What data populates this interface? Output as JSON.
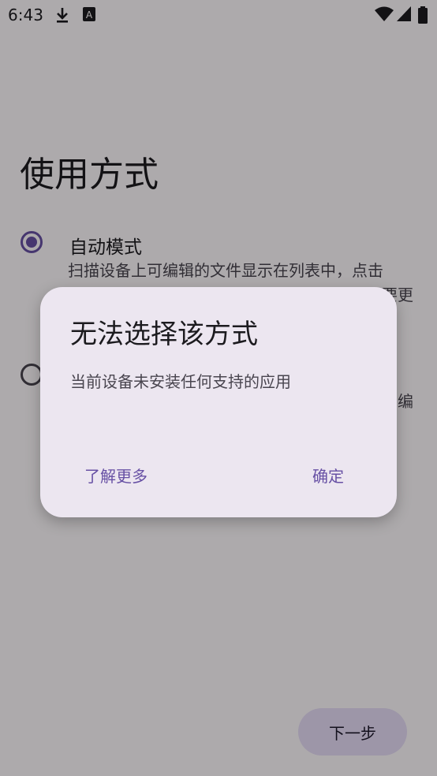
{
  "status_bar": {
    "time": "6:43",
    "icons": [
      "download-icon",
      "text-icon",
      "wifi-icon",
      "signal-icon",
      "battery-icon"
    ]
  },
  "page": {
    "title": "使用方式",
    "options": [
      {
        "label": "自动模式",
        "description": "扫描设备上可编辑的文件显示在列表中，点击",
        "description_tail": "要更",
        "selected": true
      },
      {
        "label": "",
        "description": "",
        "description_tail": "编",
        "selected": false
      }
    ],
    "next_button": "下一步"
  },
  "dialog": {
    "title": "无法选择该方式",
    "message": "当前设备未安装任何支持的应用",
    "learn_more": "了解更多",
    "confirm": "确定"
  },
  "colors": {
    "accent": "#6750a4",
    "dialog_bg": "#ece6f0",
    "scrim": "rgba(0,0,0,0.32)"
  }
}
